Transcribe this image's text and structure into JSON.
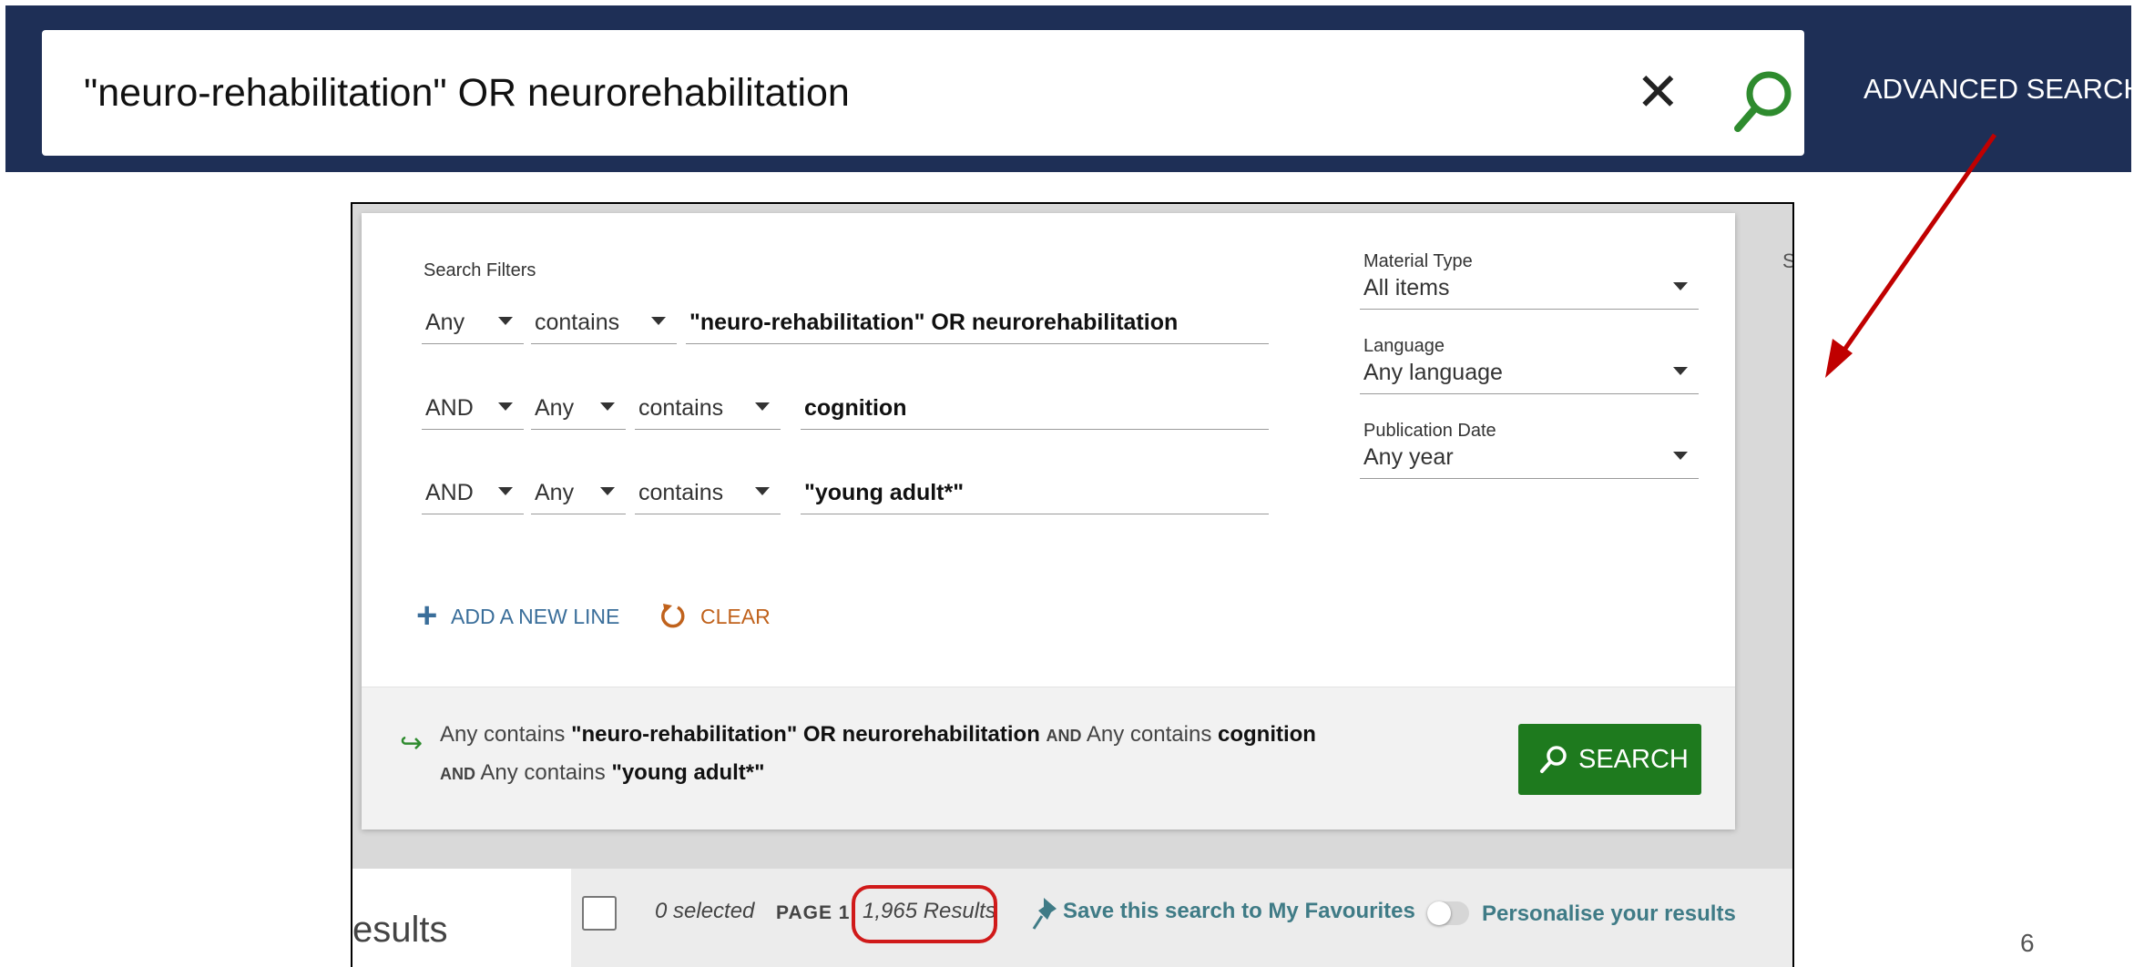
{
  "top_search": {
    "query": "\"neuro-rehabilitation\" OR neurorehabilitation",
    "clear_icon": "close-icon",
    "search_icon": "search-icon",
    "advanced_label": "ADVANCED SEARCH"
  },
  "advanced_panel": {
    "section_label": "Search Filters",
    "rows": [
      {
        "field": "Any",
        "operator": "contains",
        "value": "\"neuro-rehabilitation\" OR neurorehabilitation"
      },
      {
        "boolean": "AND",
        "field": "Any",
        "operator": "contains",
        "value": "cognition"
      },
      {
        "boolean": "AND",
        "field": "Any",
        "operator": "contains",
        "value": "\"young adult*\""
      }
    ],
    "material_type": {
      "label": "Material Type",
      "value": "All items"
    },
    "language": {
      "label": "Language",
      "value": "Any language"
    },
    "publication_date": {
      "label": "Publication Date",
      "value": "Any year"
    },
    "add_line_label": "ADD A NEW LINE",
    "clear_label": "CLEAR",
    "summary": {
      "row1": {
        "field": "Any",
        "operator": "contains",
        "value": "\"neuro-rehabilitation\" OR neurorehabilitation"
      },
      "row2": {
        "boolean": "AND",
        "field": "Any",
        "operator": "contains",
        "value": "cognition"
      },
      "row3": {
        "boolean": "AND",
        "field": "Any",
        "operator": "contains",
        "value": "\"young adult*\""
      }
    },
    "search_button_label": "SEARCH",
    "edge_text": "S"
  },
  "results_bar": {
    "results_fragment": "esults",
    "selected_text": "0 selected",
    "page_label": "PAGE 1",
    "results_count": "1,965 Results",
    "save_search_label": "Save this search to My Favourites",
    "personalise_label": "Personalise your results"
  },
  "slide_number": "6",
  "colors": {
    "header_bg": "#1e2f56",
    "search_button": "#1e7a1e",
    "highlight": "#d01a1a",
    "link_teal": "#3f7b86"
  }
}
